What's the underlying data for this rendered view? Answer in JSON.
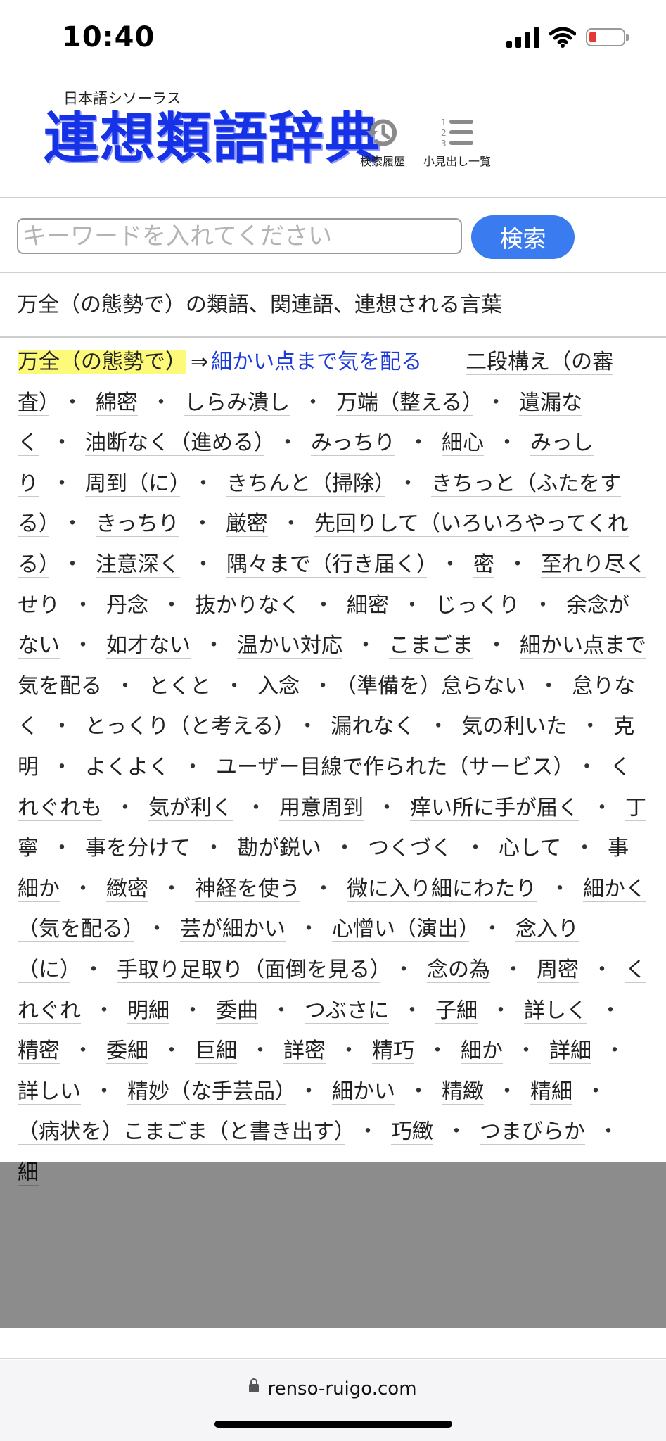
{
  "status_bar": {
    "time": "10:40"
  },
  "header": {
    "subtitle": "日本語シソーラス",
    "logo": "連想類語辞典",
    "history_label": "検索履歴",
    "headings_label": "小見出し一覧"
  },
  "search": {
    "placeholder": "キーワードを入れてください",
    "button_label": "検索"
  },
  "page_heading": "万全（の態勢で）の類語、関連語、連想される言葉",
  "entry": {
    "word": "万全（の態勢で）",
    "arrow": "⇒",
    "primary_synonym": "細かい点まで気を配る"
  },
  "synonyms": [
    "二段構え（の審査）",
    "綿密",
    "しらみ潰し",
    "万端（整える）",
    "遺漏なく",
    "油断なく（進める）",
    "みっちり",
    "細心",
    "みっしり",
    "周到（に）",
    "きちんと（掃除）",
    "きちっと（ふたをする）",
    "きっちり",
    "厳密",
    "先回りして（いろいろやってくれる）",
    "注意深く",
    "隅々まで（行き届く）",
    "密",
    "至れり尽くせり",
    "丹念",
    "抜かりなく",
    "細密",
    "じっくり",
    "余念がない",
    "如才ない",
    "温かい対応",
    "こまごま",
    "細かい点まで気を配る",
    "とくと",
    "入念",
    "（準備を）怠らない",
    "怠りなく",
    "とっくり（と考える）",
    "漏れなく",
    "気の利いた",
    "克明",
    "よくよく",
    "ユーザー目線で作られた（サービス）",
    "くれぐれも",
    "気が利く",
    "用意周到",
    "痒い所に手が届く",
    "丁寧",
    "事を分けて",
    "勘が鋭い",
    "つくづく",
    "心して",
    "事細か",
    "緻密",
    "神経を使う",
    "微に入り細にわたり",
    "細かく（気を配る）",
    "芸が細かい",
    "心憎い（演出）",
    "念入り（に）",
    "手取り足取り（面倒を見る）",
    "念の為",
    "周密",
    "くれぐれ",
    "明細",
    "委曲",
    "つぶさに",
    "子細",
    "詳しく",
    "精密",
    "委細",
    "巨細",
    "詳密",
    "精巧",
    "細か",
    "詳細",
    "詳しい",
    "精妙（な手芸品）",
    "細かい",
    "精緻",
    "精細",
    "（病状を）こまごま（と書き出す）",
    "巧緻",
    "つまびらか",
    "細"
  ],
  "separator": "・",
  "url_bar": {
    "domain": "renso-ruigo.com"
  }
}
